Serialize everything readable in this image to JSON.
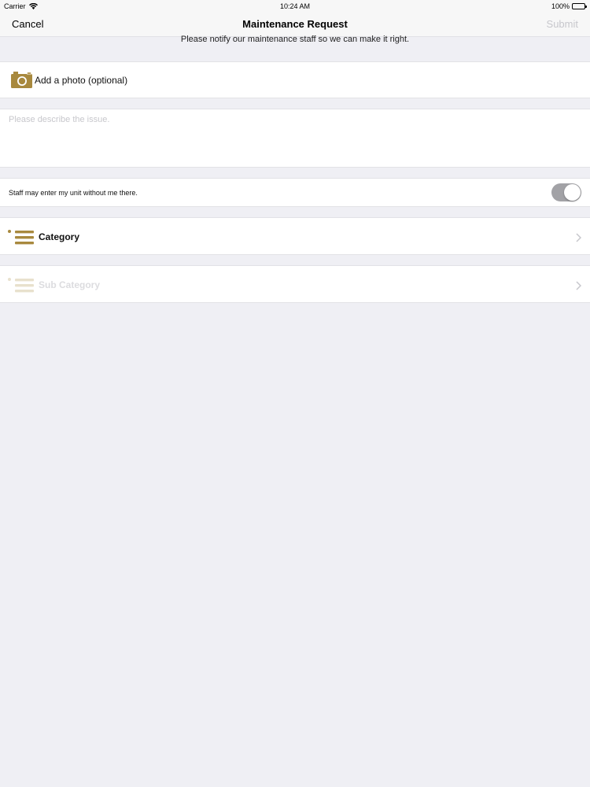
{
  "status_bar": {
    "carrier": "Carrier",
    "time": "10:24 AM",
    "battery": "100%"
  },
  "nav": {
    "cancel": "Cancel",
    "title": "Maintenance Request",
    "submit": "Submit"
  },
  "subtitle": "Please notify our maintenance staff so we can make it right.",
  "photo": {
    "label": "Add a photo (optional)",
    "icon": "camera-icon"
  },
  "description": {
    "placeholder": "Please describe the issue.",
    "value": ""
  },
  "entry_permission": {
    "label": "Staff may enter my unit without me there.",
    "enabled": true
  },
  "category": {
    "label": "Category",
    "icon": "list-icon"
  },
  "sub_category": {
    "label": "Sub Category",
    "icon": "list-icon"
  },
  "colors": {
    "accent": "#a8893e",
    "background": "#efeff4",
    "disabled_text": "#c7c7cc",
    "toggle_track": "#a2a2a6"
  }
}
